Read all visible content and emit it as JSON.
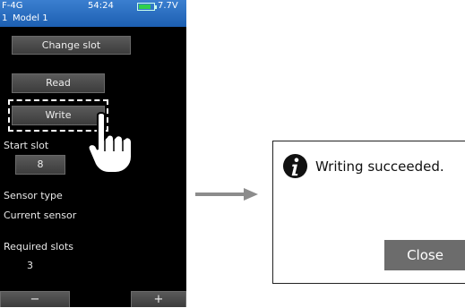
{
  "status_bar": {
    "model_prefix": "F-4G",
    "time": "54:24",
    "voltage": "7.7V",
    "battery_level": 0.8,
    "model_number": "1",
    "model_name": "Model 1"
  },
  "buttons": {
    "change_slot": "Change slot",
    "read": "Read",
    "write": "Write",
    "minus": "−",
    "plus": "+"
  },
  "fields": {
    "start_slot_label": "Start slot",
    "start_slot_value": "8",
    "sensor_type_label": "Sensor type",
    "sensor_type_value": "Current sensor",
    "required_slots_label": "Required slots",
    "required_slots_value": "3"
  },
  "dialog": {
    "message": "Writing succeeded.",
    "close_label": "Close",
    "icon": "info-icon"
  },
  "colors": {
    "status_bar": "#2a6cc0",
    "button_bg": "#4a4a4a",
    "close_bg": "#6c6c6c"
  }
}
